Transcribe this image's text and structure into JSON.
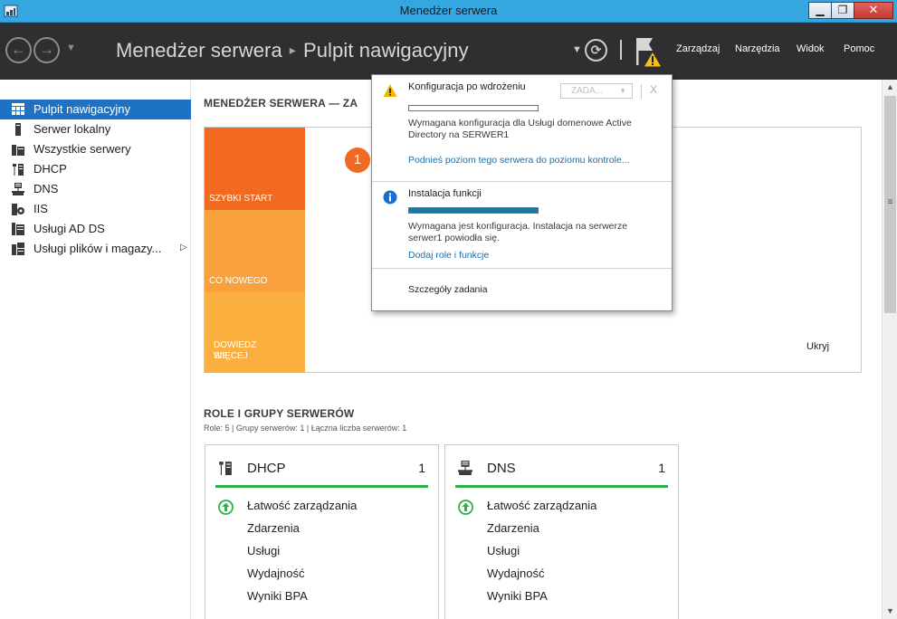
{
  "window": {
    "title": "Menedżer serwera"
  },
  "header": {
    "breadcrumb_root": "Menedżer serwera",
    "breadcrumb_sep": "▸",
    "breadcrumb_current": "Pulpit nawigacyjny",
    "menu": [
      "Zarządzaj",
      "Narzędzia",
      "Widok",
      "Pomoc"
    ]
  },
  "sidebar": {
    "items": [
      {
        "label": "Pulpit nawigacyjny",
        "icon": "dashboard-icon",
        "active": true
      },
      {
        "label": "Serwer lokalny",
        "icon": "local-server-icon",
        "active": false
      },
      {
        "label": "Wszystkie serwery",
        "icon": "all-servers-icon",
        "active": false
      },
      {
        "label": "DHCP",
        "icon": "dhcp-icon",
        "active": false
      },
      {
        "label": "DNS",
        "icon": "dns-icon",
        "active": false
      },
      {
        "label": "IIS",
        "icon": "iis-icon",
        "active": false
      },
      {
        "label": "Usługi AD DS",
        "icon": "ad-ds-icon",
        "active": false
      },
      {
        "label": "Usługi plików i magazy...",
        "icon": "file-storage-icon",
        "active": false,
        "has_submenu": true
      }
    ]
  },
  "main": {
    "welcome_title": "MENEDŻER SERWERA — ZA",
    "tiles": {
      "quick_start": "SZYBKI START",
      "whats_new": "CO NOWEGO",
      "learn_more_line1": "DOWIEDZ SIĘ",
      "learn_more_line2": "WIĘCEJ"
    },
    "step_badge": "1",
    "hide_label": "Ukryj",
    "roles_title": "ROLE I GRUPY SERWERÓW",
    "roles_subtitle": "Role: 5 | Grupy serwerów: 1 | Łączna liczba serwerów: 1",
    "cards": [
      {
        "name": "DHCP",
        "count": "1",
        "icon": "dhcp-icon",
        "rows": [
          "Łatwość zarządzania",
          "Zdarzenia",
          "Usługi",
          "Wydajność",
          "Wyniki BPA"
        ]
      },
      {
        "name": "DNS",
        "count": "1",
        "icon": "dns-icon",
        "rows": [
          "Łatwość zarządzania",
          "Zdarzenia",
          "Usługi",
          "Wydajność",
          "Wyniki BPA"
        ]
      }
    ]
  },
  "notifications": {
    "task_dropdown": "ZADA...",
    "close_label": "X",
    "items": [
      {
        "title": "Konfiguracja po wdrożeniu",
        "icon": "warning-icon",
        "progress": 0,
        "description": "Wymagana konfiguracja dla Usługi domenowe Active Directory na SERWER1",
        "links": [
          "Podnieś poziom tego serwera do poziomu kontrole..."
        ]
      },
      {
        "title": "Instalacja funkcji",
        "icon": "info-icon",
        "progress": 1.0,
        "description": "Wymagana jest konfiguracja. Instalacja na serwerze serwer1 powiodła się.",
        "links": [
          "Dodaj role i funkcje"
        ]
      }
    ],
    "details_label": "Szczegóły zadania"
  },
  "colors": {
    "accent": "#1e72c6",
    "header_bg": "#2f2f31",
    "titlebar": "#34a6e0",
    "quick_start": "#f26a21",
    "whats_new": "#f9a13c",
    "status_ok": "#2db24a",
    "link": "#1a6ea8",
    "progress": "#1779a8"
  }
}
